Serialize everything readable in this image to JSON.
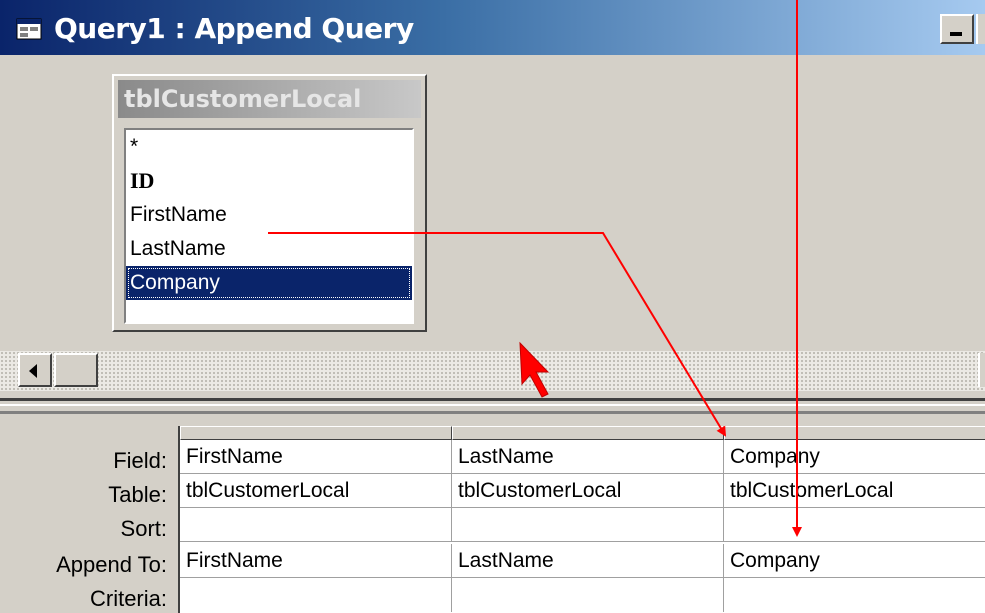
{
  "window": {
    "title": "Query1 : Append Query",
    "icon": "query-window-icon"
  },
  "design_table": {
    "name": "tblCustomerLocal",
    "fields": [
      "*",
      "ID",
      "FirstName",
      "LastName",
      "Company"
    ],
    "selected_field": "Company"
  },
  "grid": {
    "row_labels": {
      "field": "Field:",
      "table": "Table:",
      "sort": "Sort:",
      "append_to": "Append To:",
      "criteria": "Criteria:"
    },
    "columns": [
      {
        "field": "FirstName",
        "table": "tblCustomerLocal",
        "sort": "",
        "append_to": "FirstName",
        "criteria": ""
      },
      {
        "field": "LastName",
        "table": "tblCustomerLocal",
        "sort": "",
        "append_to": "LastName",
        "criteria": ""
      },
      {
        "field": "Company",
        "table": "tblCustomerLocal",
        "sort": "",
        "append_to": "Company",
        "criteria": ""
      }
    ]
  },
  "annotation_color": "#ff0000"
}
